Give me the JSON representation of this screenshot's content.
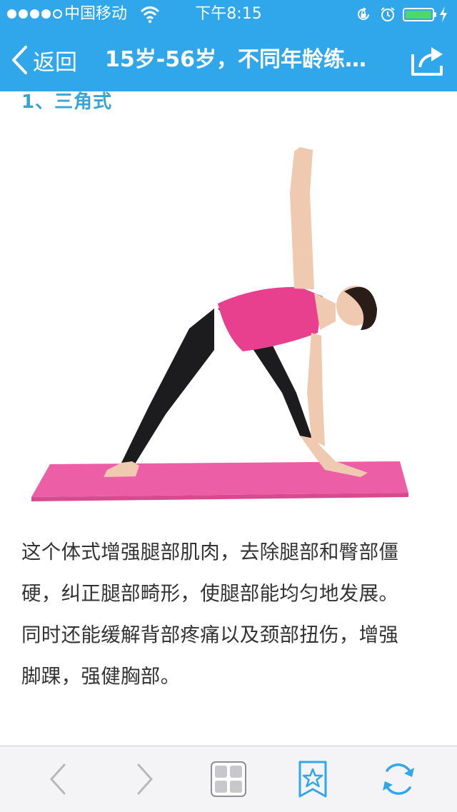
{
  "status_bar": {
    "carrier": "中国移动",
    "time": "下午8:15",
    "signal_bars": 4,
    "battery_level": 1.0,
    "battery_color": "#4cd964"
  },
  "nav": {
    "back_label": "返回",
    "title": "15岁-56岁，不同年龄练…",
    "bar_color": "#2fa7ea"
  },
  "article": {
    "section_heading": "1、三角式",
    "image_subject": "triangle yoga pose on pink mat",
    "paragraph_lines": [
      "这个体式增强腿部肌肉，去除腿部和臀部僵",
      "硬，纠正腿部畸形，使腿部能均匀地发展。",
      "同时还能缓解背部疼痛以及颈部扭伤，增强",
      "脚踝，强健胸部。"
    ],
    "heading_color": "#3aa3d6",
    "text_color": "#333333"
  },
  "toolbar": {
    "icons": [
      "chevron-left-icon",
      "chevron-right-icon",
      "grid-icon",
      "star-bookmark-icon",
      "refresh-icon"
    ],
    "accent_color": "#2fa7ea"
  }
}
